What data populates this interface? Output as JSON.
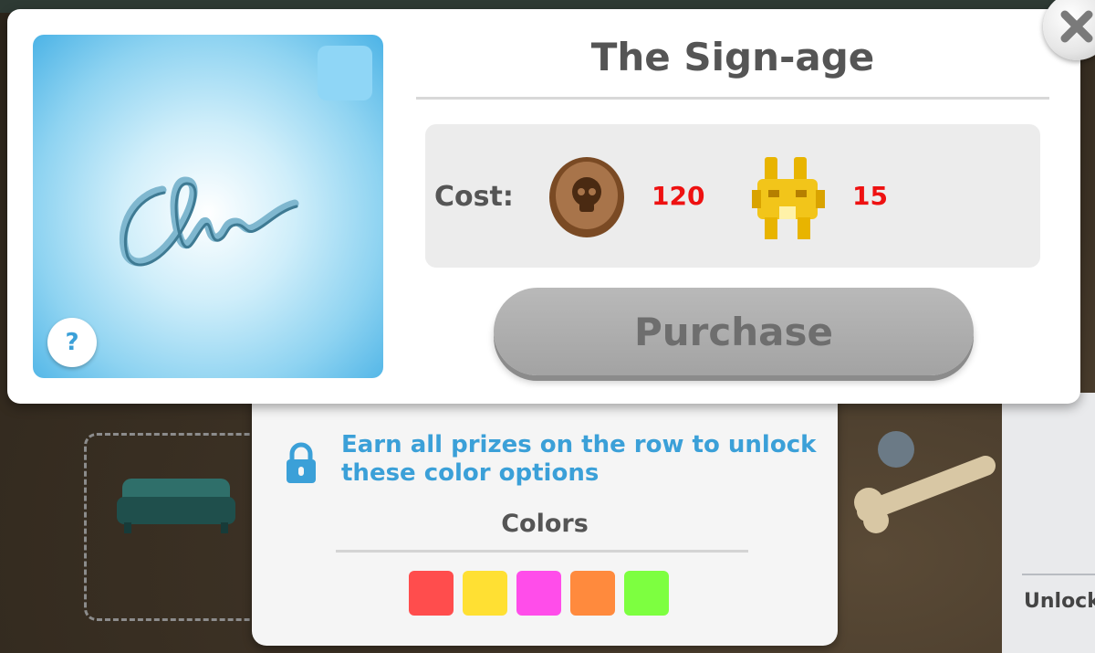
{
  "item": {
    "title": "The Sign-age",
    "help_label": "?"
  },
  "cost": {
    "label": "Cost:",
    "coins": "120",
    "totems": "15"
  },
  "purchase_label": "Purchase",
  "colors_panel": {
    "unlock_message": "Earn all prizes on the row to unlock these color options",
    "title": "Colors",
    "swatches": [
      "#ff4d4d",
      "#ffe033",
      "#ff4dea",
      "#ff8a3d",
      "#7dff40"
    ]
  },
  "side_panel": {
    "unlock_text": "Unlock"
  }
}
